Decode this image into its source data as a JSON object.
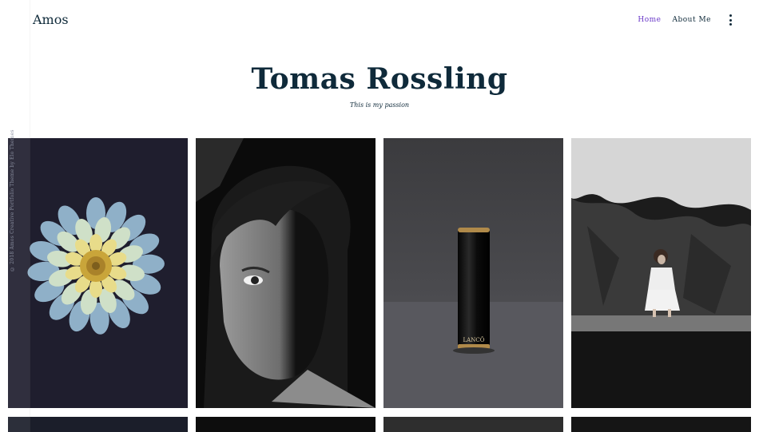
{
  "site": {
    "logo": "Amos",
    "copyright": "© 2018 Amos Creative Portfolio Theme by Elo Themes"
  },
  "nav": {
    "items": [
      {
        "label": "Home",
        "active": true
      },
      {
        "label": "About Me",
        "active": false
      }
    ],
    "menu_icon": "kebab-menu-icon"
  },
  "hero": {
    "title": "Tomas Rossling",
    "subtitle": "This is my passion"
  },
  "gallery": {
    "items": [
      {
        "subject": "dahlia flower on dark navy background"
      },
      {
        "subject": "black and white portrait of a face half in shadow"
      },
      {
        "subject": "black lipstick tube on grey fabric",
        "label": "LANCÔ"
      },
      {
        "subject": "woman crouching on rocky shore, black and white"
      }
    ]
  },
  "colors": {
    "accent": "#6a39c8",
    "text": "#0f2a3a"
  }
}
